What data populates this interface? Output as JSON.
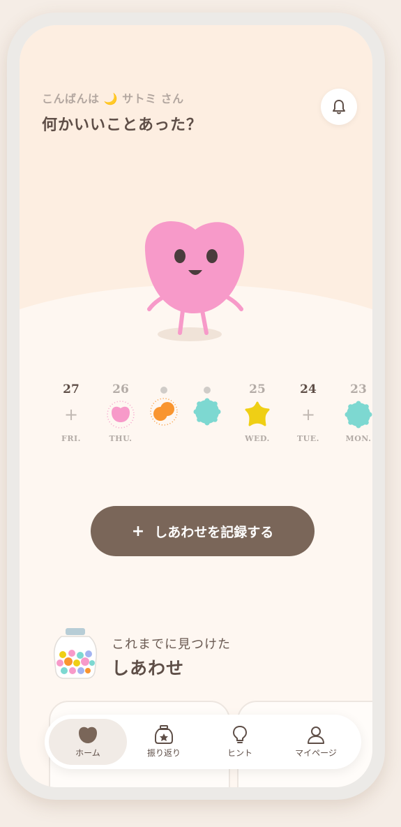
{
  "header": {
    "greeting_prefix": "こんばんは",
    "greeting_moon": "🌙",
    "greeting_name": "サトミ さん",
    "question": "何かいいことあった？"
  },
  "calendar": [
    {
      "number": "27",
      "icon": "plus",
      "label": "FRI.",
      "active": true
    },
    {
      "number": "26",
      "icon": "pink-heart-blob",
      "label": "THU.",
      "active": false
    },
    {
      "number": "",
      "icon": "orange-double-blob",
      "label": "",
      "active": false
    },
    {
      "number": "",
      "icon": "teal-flower-blob",
      "label": "",
      "active": false
    },
    {
      "number": "25",
      "icon": "yellow-star-blob",
      "label": "WED.",
      "active": false
    },
    {
      "number": "24",
      "icon": "plus",
      "label": "TUE.",
      "active": true
    },
    {
      "number": "23",
      "icon": "teal-flower-blob",
      "label": "MON.",
      "active": false
    }
  ],
  "record_button": {
    "plus": "+",
    "label": "しあわせを記録する"
  },
  "found": {
    "subtitle": "これまでに見つけた",
    "title": "しあわせ"
  },
  "tabs": [
    {
      "label": "ホーム",
      "icon": "heart-icon",
      "active": true
    },
    {
      "label": "振り返り",
      "icon": "jar-icon",
      "active": false
    },
    {
      "label": "ヒント",
      "icon": "lightbulb-icon",
      "active": false
    },
    {
      "label": "マイページ",
      "icon": "person-icon",
      "active": false
    }
  ],
  "colors": {
    "brand_brown": "#7a6659",
    "text_dark": "#5e4e47",
    "mascot_pink": "#f79ac9",
    "orange": "#f9952f",
    "teal": "#7dd8d1",
    "yellow": "#efcf15"
  }
}
